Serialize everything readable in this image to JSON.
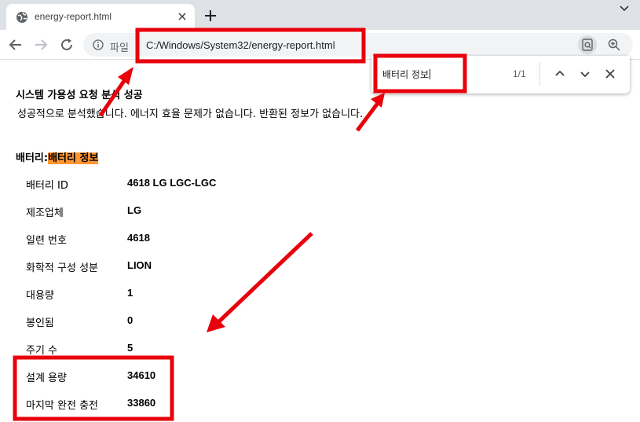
{
  "browser": {
    "tab": {
      "title": "energy-report.html"
    },
    "address": {
      "scheme_label": "파일",
      "url": "C:/Windows/System32/energy-report.html"
    },
    "find": {
      "query": "배터리 정보",
      "count": "1/1"
    }
  },
  "page": {
    "section_title": "시스템 가용성 요청 분석 성공",
    "section_desc": "성공적으로 분석했습니다. 에너지 효율 문제가 없습니다. 반환된 정보가 없습니다.",
    "battery_heading_prefix": "배터리:",
    "battery_heading_highlight": "배터리 정보",
    "battery_rows": [
      {
        "label": "배터리 ID",
        "value": "4618 LG LGC-LGC"
      },
      {
        "label": "제조업체",
        "value": "LG"
      },
      {
        "label": "일련 번호",
        "value": "4618"
      },
      {
        "label": "화학적 구성 성분",
        "value": "LION"
      },
      {
        "label": "대용량",
        "value": "1"
      },
      {
        "label": "봉인됨",
        "value": "0"
      },
      {
        "label": "주기 수",
        "value": "5"
      },
      {
        "label": "설계 용량",
        "value": "34610"
      },
      {
        "label": "마지막 완전 충전",
        "value": "33860"
      }
    ]
  },
  "colors": {
    "annotation": "#e8000b",
    "find_highlight": "#ff9632",
    "tab_strip": "#dee1e6"
  },
  "icons": [
    "globe-icon",
    "close-icon",
    "plus-icon",
    "chevron-down-icon",
    "back-arrow-icon",
    "forward-arrow-icon",
    "reload-icon",
    "info-icon",
    "lens-icon",
    "zoom-icon",
    "chevron-up-icon"
  ]
}
